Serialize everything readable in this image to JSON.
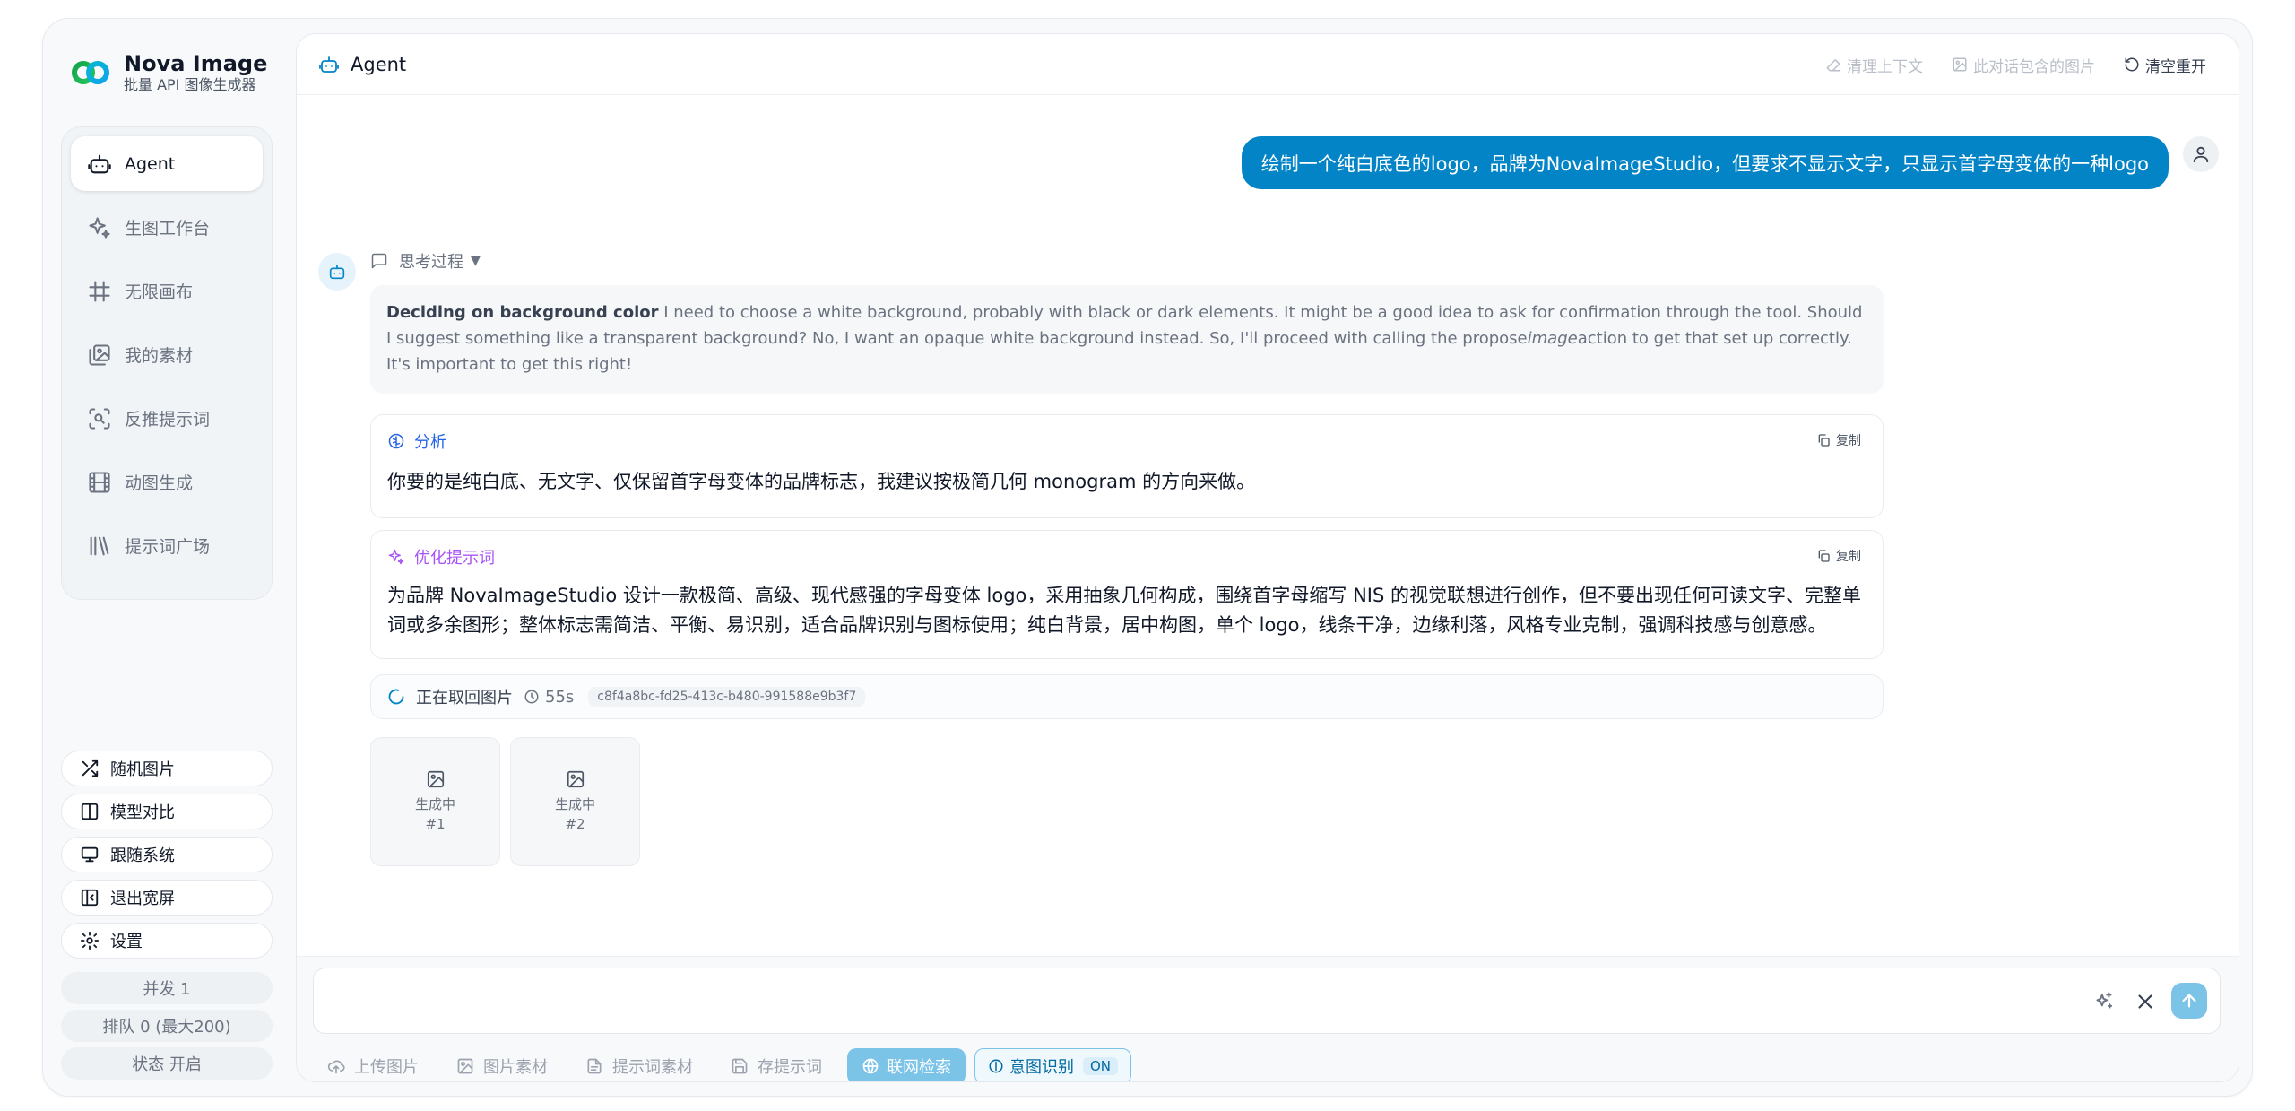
{
  "brand": {
    "name": "Nova Image",
    "subtitle": "批量 API 图像生成器"
  },
  "nav": [
    {
      "label": "Agent",
      "icon": "robot-icon",
      "active": true
    },
    {
      "label": "生图工作台",
      "icon": "sparkles-icon"
    },
    {
      "label": "无限画布",
      "icon": "hash-frame-icon"
    },
    {
      "label": "我的素材",
      "icon": "images-icon"
    },
    {
      "label": "反推提示词",
      "icon": "scan-search-icon"
    },
    {
      "label": "动图生成",
      "icon": "film-icon"
    },
    {
      "label": "提示词广场",
      "icon": "library-icon"
    }
  ],
  "utilities": [
    {
      "label": "随机图片",
      "icon": "shuffle-icon"
    },
    {
      "label": "模型对比",
      "icon": "columns-icon"
    },
    {
      "label": "跟随系统",
      "icon": "monitor-icon"
    },
    {
      "label": "退出宽屏",
      "icon": "collapse-icon"
    },
    {
      "label": "设置",
      "icon": "gear-icon"
    }
  ],
  "stats": {
    "concurrency": "并发 1",
    "queue": "排队 0 (最大200)",
    "status": "状态 开启"
  },
  "header": {
    "title": "Agent",
    "actions": {
      "clear_context": "清理上下文",
      "images_in_chat": "此对话包含的图片",
      "reset": "清空重开"
    }
  },
  "chat": {
    "user_message": "绘制一个纯白底色的logo，品牌为NovaImageStudio，但要求不显示文字，只显示首字母变体的一种logo",
    "thinking_label": "思考过程",
    "thinking": {
      "heading": "Deciding on background color",
      "text_a": " I need to choose a white background, probably with black or dark elements. It might be a good idea to ask for confirmation through the tool. Should I suggest something like a transparent background? No, I want an opaque white background instead. So, I'll proceed with calling the propose",
      "text_em": "image",
      "text_b": "action to get that set up correctly. It's important to get this right!"
    },
    "analysis": {
      "title": "分析",
      "copy": "复制",
      "body": "你要的是纯白底、无文字、仅保留首字母变体的品牌标志，我建议按极简几何 monogram 的方向来做。"
    },
    "optimized": {
      "title": "优化提示词",
      "copy": "复制",
      "body": "为品牌 NovaImageStudio 设计一款极简、高级、现代感强的字母变体 logo，采用抽象几何构成，围绕首字母缩写 NIS 的视觉联想进行创作，但不要出现任何可读文字、完整单词或多余图形；整体标志需简洁、平衡、易识别，适合品牌识别与图标使用；纯白背景，居中构图，单个 logo，线条干净，边缘利落，风格专业克制，强调科技感与创意感。"
    },
    "status": {
      "text": "正在取回图片",
      "elapsed": "55s",
      "job_id": "c8f4a8bc-fd25-413c-b480-991588e9b3f7"
    },
    "thumbs": [
      {
        "state": "生成中",
        "index": "#1"
      },
      {
        "state": "生成中",
        "index": "#2"
      }
    ]
  },
  "composer": {
    "placeholder": "",
    "tools": {
      "upload": "上传图片",
      "image_assets": "图片素材",
      "prompt_assets": "提示词素材",
      "save_prompt": "存提示词",
      "web_search": "联网检索",
      "intent": "意图识别",
      "intent_state": "ON"
    }
  },
  "colors": {
    "accent": "#0284c7",
    "accent_light": "#7cc3e8",
    "analysis": "#2563eb",
    "optimize": "#a855f7"
  }
}
